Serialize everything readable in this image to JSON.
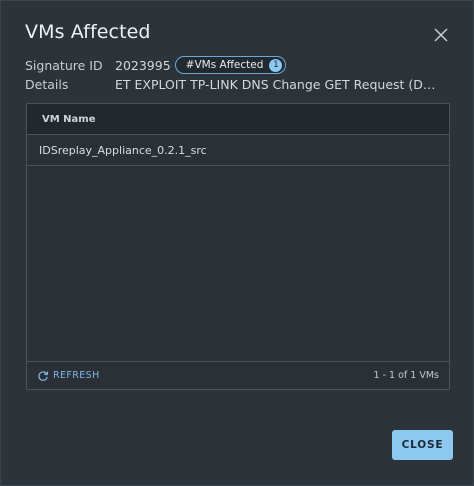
{
  "dialog": {
    "title": "VMs Affected",
    "close_icon": "close-icon"
  },
  "signature": {
    "label": "Signature ID",
    "value": "2023995",
    "badge_label": "#VMs Affected",
    "badge_count": "1"
  },
  "details": {
    "label": "Details",
    "value": "ET EXPLOIT TP-LINK DNS Change GET Request (DNSChanger EK)"
  },
  "grid": {
    "columns": [
      "VM Name"
    ],
    "rows": [
      [
        "IDSreplay_Appliance_0.2.1_src"
      ]
    ],
    "refresh_label": "REFRESH",
    "refresh_icon": "refresh-icon",
    "pagination": "1 - 1 of 1 VMs"
  },
  "footer": {
    "close_label": "CLOSE"
  },
  "colors": {
    "accent": "#8cc8f0",
    "link": "#7fb7e4",
    "background": "#2d3439"
  }
}
